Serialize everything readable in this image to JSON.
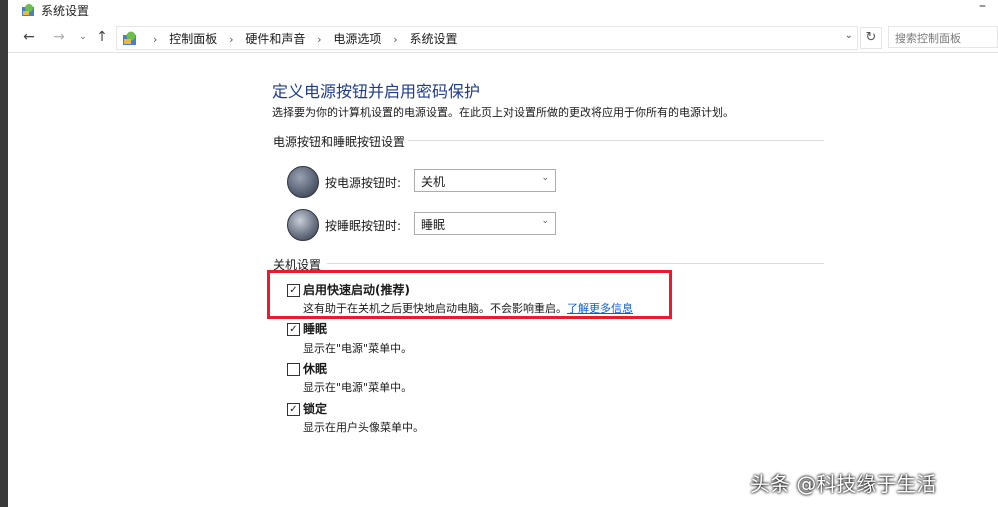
{
  "window": {
    "title": "系统设置",
    "minimize_glyph": "–"
  },
  "nav": {
    "back_glyph": "←",
    "forward_glyph": "→",
    "recent_glyph": "⌄",
    "up_glyph": "↑",
    "breadcrumbs": [
      "控制面板",
      "硬件和声音",
      "电源选项",
      "系统设置"
    ],
    "separator": "›",
    "dropdown_glyph": "⌄",
    "refresh_glyph": "↻",
    "search_placeholder": "搜索控制面板"
  },
  "content": {
    "heading": "定义电源按钮并启用密码保护",
    "subtitle": "选择要为你的计算机设置的电源设置。在此页上对设置所做的更改将应用于你所有的电源计划。",
    "buttons_group": {
      "title": "电源按钮和睡眠按钮设置",
      "power_label": "按电源按钮时:",
      "power_value": "关机",
      "sleep_label": "按睡眠按钮时:",
      "sleep_value": "睡眠"
    },
    "shutdown_group": {
      "title": "关机设置",
      "options": [
        {
          "label": "启用快速启动(推荐)",
          "desc": "这有助于在关机之后更快地启动电脑。不会影响重启。",
          "link": "了解更多信息",
          "checked": true
        },
        {
          "label": "睡眠",
          "desc": "显示在\"电源\"菜单中。",
          "checked": true
        },
        {
          "label": "休眠",
          "desc": "显示在\"电源\"菜单中。",
          "checked": false
        },
        {
          "label": "锁定",
          "desc": "显示在用户头像菜单中。",
          "checked": true
        }
      ]
    }
  },
  "check_glyph": "✓",
  "select_chevron": "⌄",
  "watermark": "头条 @科技缘于生活",
  "colors": {
    "heading": "#1f3c8a",
    "link": "#0b5ed7",
    "highlight": "#e81c2e"
  }
}
